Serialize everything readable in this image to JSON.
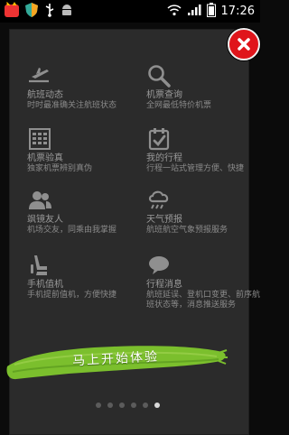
{
  "status_bar": {
    "time": "17:26",
    "icons": [
      "notification-app-icon",
      "shield-icon",
      "usb-icon",
      "android-icon",
      "wifi-icon",
      "signal-icon",
      "battery-icon"
    ]
  },
  "overlay": {
    "close_icon": "close-icon",
    "features": [
      {
        "icon": "airplane-takeoff-icon",
        "title": "航班动态",
        "desc": "时时最准确关注航班状态"
      },
      {
        "icon": "search-icon",
        "title": "机票查询",
        "desc": "全网最低特价机票"
      },
      {
        "icon": "ticket-verify-icon",
        "title": "机票验真",
        "desc": "独家机票辨别真伪"
      },
      {
        "icon": "calendar-check-icon",
        "title": "我的行程",
        "desc": "行程一站式管理方便、快捷"
      },
      {
        "icon": "friends-icon",
        "title": "飒镜友人",
        "desc": "机场交友，同乘由我掌握"
      },
      {
        "icon": "weather-icon",
        "title": "天气预报",
        "desc": "航班航空气象预报服务"
      },
      {
        "icon": "seat-icon",
        "title": "手机值机",
        "desc": "手机提前值机，方便快捷"
      },
      {
        "icon": "message-bubble-icon",
        "title": "行程消息",
        "desc": "航班延误、登机口变更、前序航班状态等，消息推送服务"
      }
    ],
    "cta_label": "马上开始体验",
    "pager": {
      "count": 6,
      "active_index": 5
    }
  },
  "colors": {
    "close_red": "#e0151b",
    "cta_green": "#7bbf2d",
    "panel_bg": "#2b2b2b"
  }
}
